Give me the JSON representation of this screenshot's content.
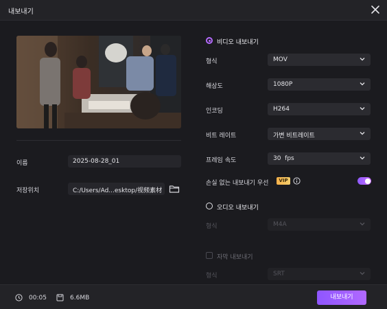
{
  "window": {
    "title": "내보내기"
  },
  "left": {
    "name_label": "이름",
    "name_value": "2025-08-28_01",
    "save_label": "저장위치",
    "save_path": "C:/Users/Ad...esktop/视频素材"
  },
  "video": {
    "section_label": "비디오 내보내기",
    "selected": true,
    "rows": [
      {
        "label": "형식",
        "value": "MOV"
      },
      {
        "label": "해상도",
        "value": "1080P"
      },
      {
        "label": "인코딩",
        "value": "H264"
      },
      {
        "label": "비트 레이트",
        "value": "가변 비트레이트"
      },
      {
        "label": "프레임 속도",
        "value": "30  fps"
      }
    ],
    "lossless_label": "손실 없는 내보내기 우선",
    "vip_badge": "VIP",
    "lossless_on": true
  },
  "audio": {
    "section_label": "오디오 내보내기",
    "selected": false,
    "format_label": "형식",
    "format_value": "M4A"
  },
  "subtitle": {
    "checkbox_label": "자막 내보내기",
    "checked": false,
    "format_label": "형식",
    "format_value": "SRT"
  },
  "footer": {
    "duration": "00:05",
    "size": "6.6MB",
    "export_button": "내보내기"
  },
  "colors": {
    "accent": "#b56bff",
    "background": "#1b1b1f",
    "panel": "#232327"
  }
}
